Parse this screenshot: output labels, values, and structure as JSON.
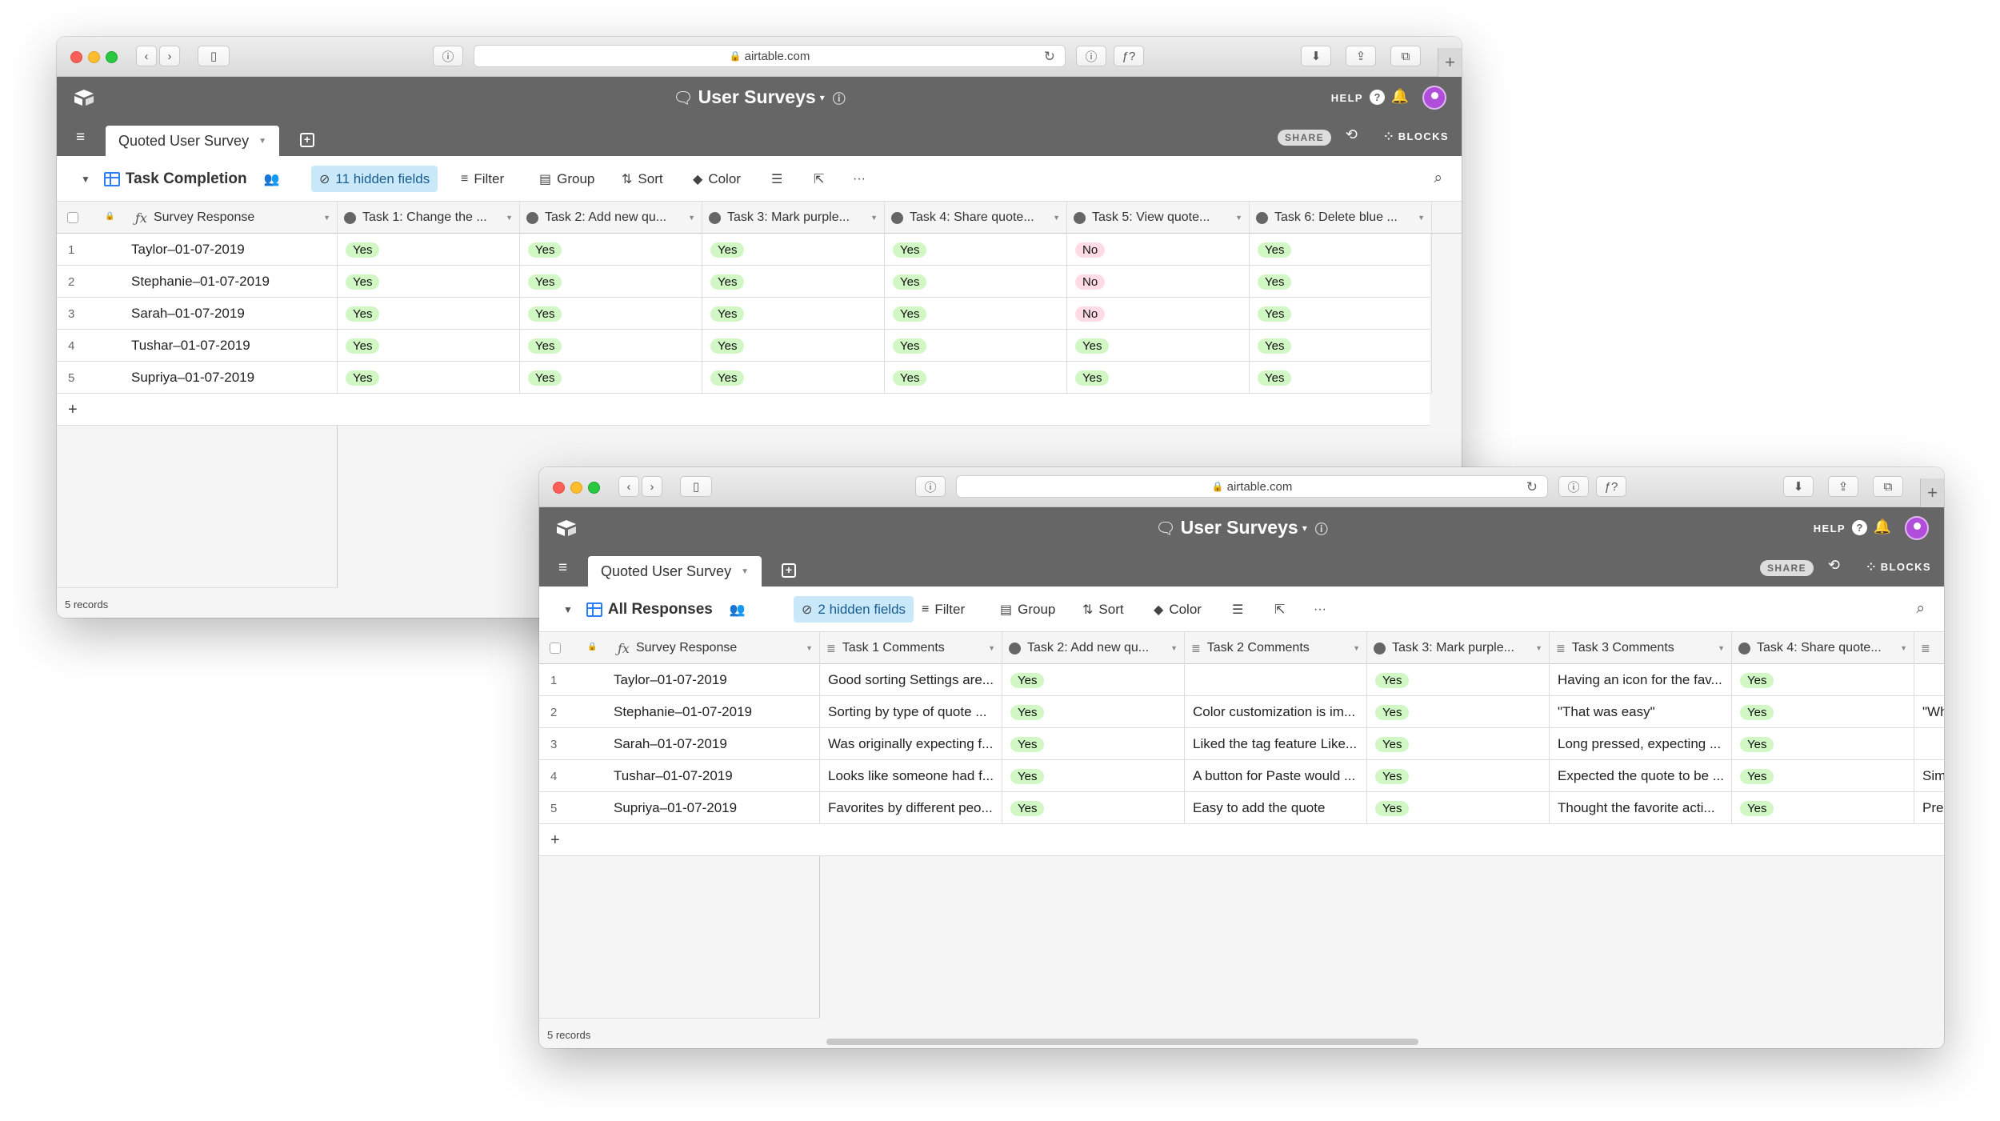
{
  "windows": [
    {
      "url": "airtable.com",
      "base_title": "User Surveys",
      "table_tab": "Quoted User Survey",
      "help": "HELP",
      "share": "SHARE",
      "blocks": "BLOCKS",
      "view_name": "Task Completion",
      "hidden_fields": "11 hidden fields",
      "filter": "Filter",
      "group": "Group",
      "sort": "Sort",
      "color": "Color",
      "columns": [
        "Survey Response",
        "Task 1: Change the ...",
        "Task 2: Add new qu...",
        "Task 3: Mark purple...",
        "Task 4: Share quote...",
        "Task 5: View quote...",
        "Task 6: Delete blue ..."
      ],
      "column_types": [
        "formula",
        "select",
        "select",
        "select",
        "select",
        "select",
        "select"
      ],
      "rows": [
        {
          "num": "1",
          "cells": [
            "Taylor–01-07-2019",
            "Yes",
            "Yes",
            "Yes",
            "Yes",
            "No",
            "Yes"
          ]
        },
        {
          "num": "2",
          "cells": [
            "Stephanie–01-07-2019",
            "Yes",
            "Yes",
            "Yes",
            "Yes",
            "No",
            "Yes"
          ]
        },
        {
          "num": "3",
          "cells": [
            "Sarah–01-07-2019",
            "Yes",
            "Yes",
            "Yes",
            "Yes",
            "No",
            "Yes"
          ]
        },
        {
          "num": "4",
          "cells": [
            "Tushar–01-07-2019",
            "Yes",
            "Yes",
            "Yes",
            "Yes",
            "Yes",
            "Yes"
          ]
        },
        {
          "num": "5",
          "cells": [
            "Supriya–01-07-2019",
            "Yes",
            "Yes",
            "Yes",
            "Yes",
            "Yes",
            "Yes"
          ]
        }
      ],
      "add_row": "+",
      "records": "5 records"
    },
    {
      "url": "airtable.com",
      "base_title": "User Surveys",
      "table_tab": "Quoted User Survey",
      "help": "HELP",
      "share": "SHARE",
      "blocks": "BLOCKS",
      "view_name": "All Responses",
      "hidden_fields": "2 hidden fields",
      "filter": "Filter",
      "group": "Group",
      "sort": "Sort",
      "color": "Color",
      "columns": [
        "Survey Response",
        "Task 1 Comments",
        "Task 2: Add new qu...",
        "Task 2 Comments",
        "Task 3: Mark purple...",
        "Task 3 Comments",
        "Task 4: Share quote...",
        ""
      ],
      "column_types": [
        "formula",
        "text",
        "select",
        "text",
        "select",
        "text",
        "select",
        "text"
      ],
      "rows": [
        {
          "num": "1",
          "cells": [
            "Taylor–01-07-2019",
            "Good sorting Settings are...",
            "Yes",
            "",
            "Yes",
            "Having an icon for the fav...",
            "Yes",
            ""
          ]
        },
        {
          "num": "2",
          "cells": [
            "Stephanie–01-07-2019",
            "Sorting by type of quote ...",
            "Yes",
            "Color customization is im...",
            "Yes",
            "\"That was easy\"",
            "Yes",
            "\"Wh"
          ]
        },
        {
          "num": "3",
          "cells": [
            "Sarah–01-07-2019",
            "Was originally expecting f...",
            "Yes",
            "Liked the tag feature Like...",
            "Yes",
            "Long pressed, expecting ...",
            "Yes",
            ""
          ]
        },
        {
          "num": "4",
          "cells": [
            "Tushar–01-07-2019",
            "Looks like someone had f...",
            "Yes",
            "A button for Paste would ...",
            "Yes",
            "Expected the quote to be ...",
            "Yes",
            "Sim"
          ]
        },
        {
          "num": "5",
          "cells": [
            "Supriya–01-07-2019",
            "Favorites by different peo...",
            "Yes",
            "Easy to add the quote",
            "Yes",
            "Thought the favorite acti...",
            "Yes",
            "Pre"
          ]
        }
      ],
      "add_row": "+",
      "records": "5 records"
    }
  ],
  "colors": {
    "yes_pill": "#d1f7c4",
    "no_pill": "#ffdce5",
    "header_bar": "#666666",
    "hidden_fields_bg": "#c9e9fb",
    "accent": "#2d7ff9"
  }
}
